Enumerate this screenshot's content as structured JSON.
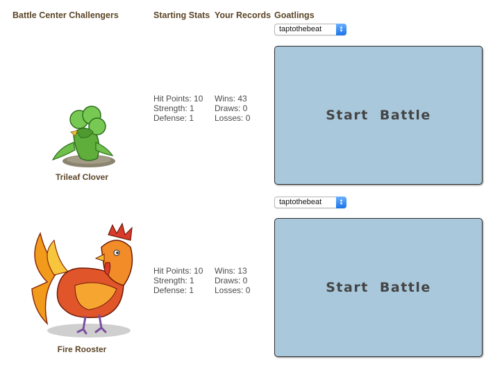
{
  "headers": {
    "challengers": "Battle Center Challengers",
    "starting_stats": "Starting Stats",
    "your_records": "Your Records",
    "goatlings": "Goatlings"
  },
  "challengers": [
    {
      "name": "Trileaf Clover",
      "stats": {
        "hp": "Hit Points: 10",
        "strength": "Strength: 1",
        "defense": "Defense: 1"
      },
      "records": {
        "wins": "Wins: 43",
        "draws": "Draws: 0",
        "losses": "Losses: 0"
      },
      "goatling_selected": "taptothebeat",
      "battle_label": "Start  Battle"
    },
    {
      "name": "Fire Rooster",
      "stats": {
        "hp": "Hit Points: 10",
        "strength": "Strength: 1",
        "defense": "Defense: 1"
      },
      "records": {
        "wins": "Wins: 13",
        "draws": "Draws: 0",
        "losses": "Losses: 0"
      },
      "goatling_selected": "taptothebeat",
      "battle_label": "Start  Battle"
    }
  ],
  "colors": {
    "header_text": "#5b4526",
    "battle_button_bg": "#a9c8dc",
    "select_accent": "#1a73e8"
  }
}
